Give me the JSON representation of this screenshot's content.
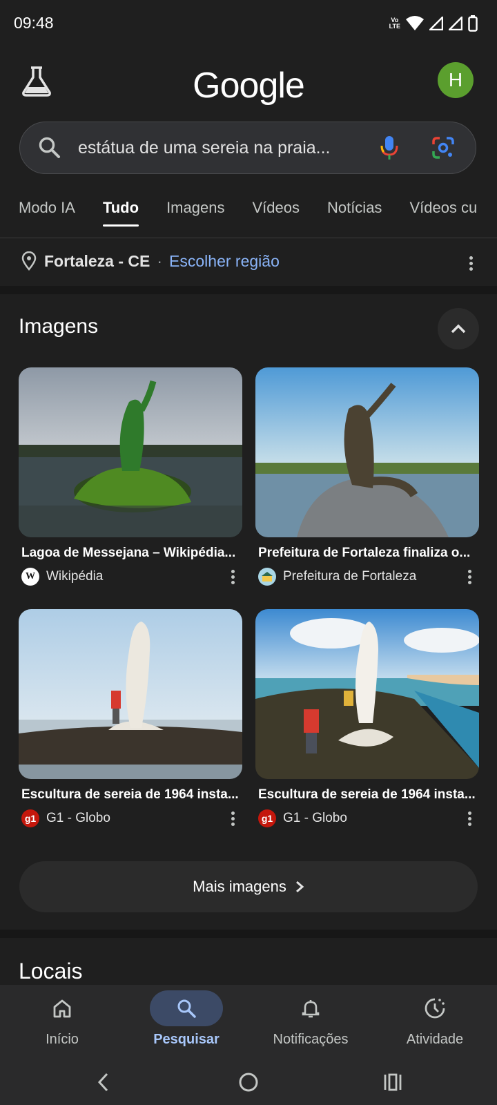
{
  "status_bar": {
    "time": "09:48",
    "icons": [
      "volte-icon",
      "wifi-icon",
      "signal-icon",
      "signal-icon",
      "battery-icon"
    ],
    "volte_text": "Vo\nLTE"
  },
  "header": {
    "logo_text": "Google",
    "avatar_letter": "H",
    "avatar_color": "#5b9f2e"
  },
  "search": {
    "query": "estátua de uma sereia na praia..."
  },
  "tabs": [
    {
      "label": "Modo IA",
      "active": false
    },
    {
      "label": "Tudo",
      "active": true
    },
    {
      "label": "Imagens",
      "active": false
    },
    {
      "label": "Vídeos",
      "active": false
    },
    {
      "label": "Notícias",
      "active": false
    },
    {
      "label": "Vídeos cu",
      "active": false
    }
  ],
  "location": {
    "city": "Fortaleza - CE",
    "separator": "·",
    "link": "Escolher região"
  },
  "images_section": {
    "title": "Imagens",
    "results": [
      {
        "caption": "Lagoa de Messejana – Wikipédia...",
        "source": "Wikipédia",
        "source_logo": "W"
      },
      {
        "caption": "Prefeitura de Fortaleza finaliza o...",
        "source": "Prefeitura de Fortaleza",
        "source_logo": ""
      },
      {
        "caption": "Escultura de sereia de 1964 insta...",
        "source": "G1 - Globo",
        "source_logo": "g1"
      },
      {
        "caption": "Escultura de sereia de 1964 insta...",
        "source": "G1 - Globo",
        "source_logo": "g1"
      }
    ],
    "more_button": "Mais imagens"
  },
  "places_section": {
    "title": "Locais"
  },
  "bottom_nav": [
    {
      "label": "Início",
      "icon": "home-icon",
      "active": false
    },
    {
      "label": "Pesquisar",
      "icon": "search-icon",
      "active": true
    },
    {
      "label": "Notificações",
      "icon": "bell-icon",
      "active": false
    },
    {
      "label": "Atividade",
      "icon": "activity-icon",
      "active": false
    }
  ],
  "colors": {
    "background": "#1f1f1f",
    "link": "#8ab4f8",
    "active_nav": "#a8c7fa",
    "g1_red": "#c4170c"
  }
}
